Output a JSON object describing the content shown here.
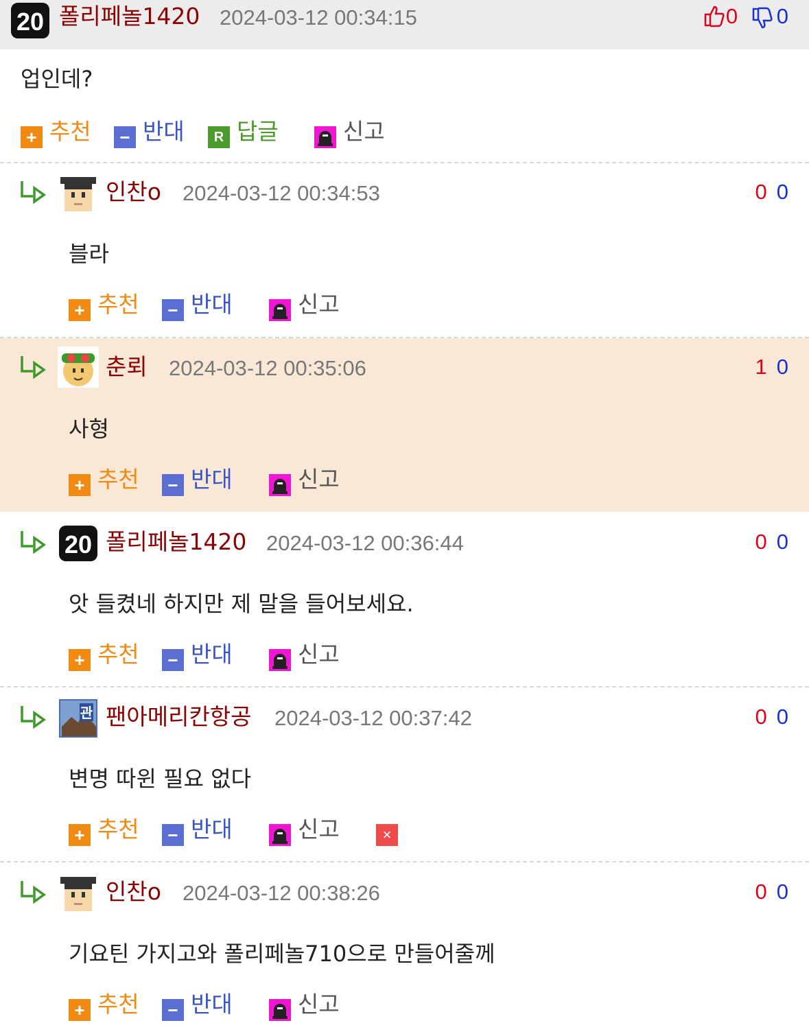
{
  "comments": [
    {
      "nick": "폴리페놀1420",
      "date": "2024-03-12 00:34:15",
      "up": "0",
      "down": "0",
      "body": "업인데?",
      "avatar": "badge-20-icon"
    },
    {
      "nick": "인찬o",
      "date": "2024-03-12 00:34:53",
      "up": "0",
      "down": "0",
      "body": "블라",
      "avatar": "graduate-avatar-icon"
    },
    {
      "nick": "춘뢰",
      "date": "2024-03-12 00:35:06",
      "up": "1",
      "down": "0",
      "body": "사형",
      "avatar": "goggles-avatar-icon"
    },
    {
      "nick": "폴리페놀1420",
      "date": "2024-03-12 00:36:44",
      "up": "0",
      "down": "0",
      "body": "앗 들켰네 하지만 제 말을 들어보세요.",
      "avatar": "badge-20-icon"
    },
    {
      "nick": "팬아메리칸항공",
      "date": "2024-03-12 00:37:42",
      "up": "0",
      "down": "0",
      "body": "변명 따윈 필요 없다",
      "avatar": "photo-avatar-icon"
    },
    {
      "nick": "인찬o",
      "date": "2024-03-12 00:38:26",
      "up": "0",
      "down": "0",
      "body": "기요틴 가지고와 폴리페놀710으로 만들어줄께",
      "avatar": "graduate-avatar-icon"
    }
  ],
  "actions": {
    "recommend": "추천",
    "oppose": "반대",
    "reply": "답글",
    "report": "신고"
  },
  "colors": {
    "nick": "#8b0000",
    "upvote": "#e0001b",
    "downvote": "#1a2fd6",
    "highlight_bg": "#fae8d7",
    "header_bg": "#ececec"
  }
}
